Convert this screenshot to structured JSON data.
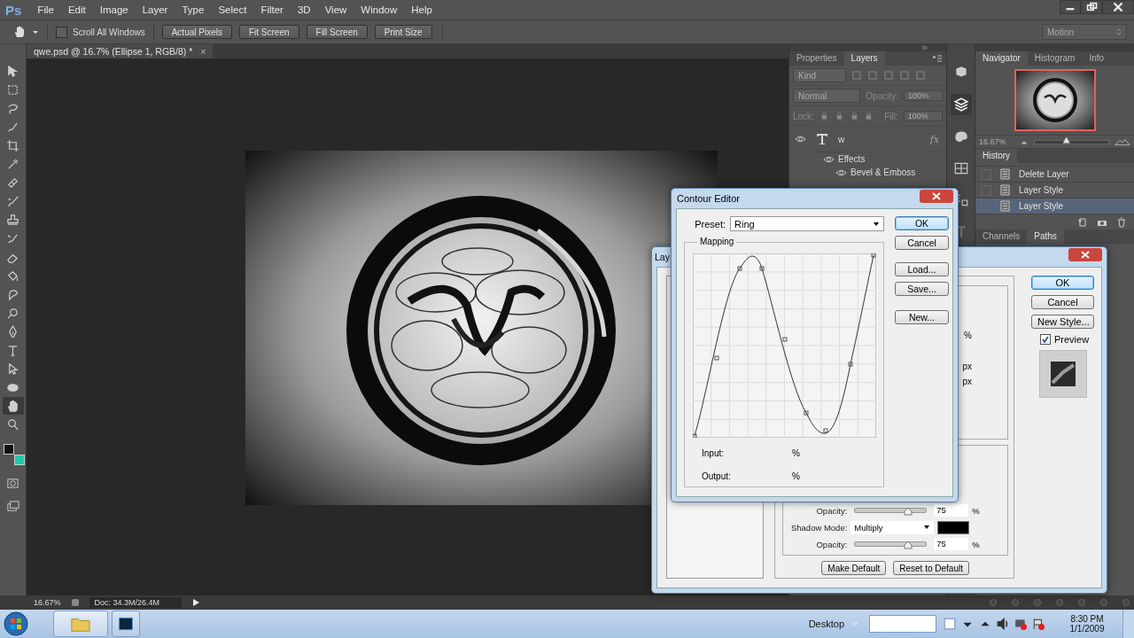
{
  "app_logo": "Ps",
  "menu": [
    "File",
    "Edit",
    "Image",
    "Layer",
    "Type",
    "Select",
    "Filter",
    "3D",
    "View",
    "Window",
    "Help"
  ],
  "options_bar": {
    "scroll_all_windows": {
      "label": "Scroll All Windows",
      "checked": false
    },
    "buttons": [
      "Actual Pixels",
      "Fit Screen",
      "Fill Screen",
      "Print Size"
    ],
    "workspace": "Motion"
  },
  "document_tab": {
    "title": "qwe.psd @ 16.7% (Ellipse 1, RGB/8) *",
    "close": "×"
  },
  "tools": [
    {
      "selected": false
    },
    {
      "selected": false
    },
    {
      "selected": false
    },
    {
      "selected": false
    },
    {
      "selected": false
    },
    {
      "selected": false
    },
    {
      "selected": false
    },
    {
      "selected": false
    },
    {
      "selected": false
    },
    {
      "selected": false
    },
    {
      "selected": false
    },
    {
      "selected": false
    },
    {
      "selected": false
    },
    {
      "selected": false
    },
    {
      "selected": false
    },
    {
      "selected": false
    },
    {
      "selected": false
    },
    {
      "selected": false
    },
    {
      "selected": true
    },
    {
      "selected": false
    }
  ],
  "swatches": [
    {
      "color": "#111111"
    },
    {
      "color": "#1fc9ae"
    }
  ],
  "layers_panel": {
    "tabs": [
      {
        "label": "Properties",
        "selected": false
      },
      {
        "label": "Layers",
        "selected": true
      }
    ],
    "filter": "Kind",
    "blend_mode": "Normal",
    "opacity_label": "Opacity:",
    "opacity": "100%",
    "lock_label": "Lock:",
    "fill_label": "Fill:",
    "fill": "100%",
    "layers": [
      {
        "name": "w",
        "visible": true,
        "fx": "fx",
        "children": [
          {
            "name": "Effects",
            "visible": true,
            "children": [
              {
                "name": "Bevel & Emboss",
                "visible": true
              }
            ]
          }
        ]
      }
    ]
  },
  "navigator": {
    "tabs": [
      {
        "label": "Navigator",
        "selected": true
      },
      {
        "label": "Histogram",
        "selected": false
      },
      {
        "label": "Info",
        "selected": false
      }
    ],
    "zoom": "16.67%",
    "level": 0.43
  },
  "history": {
    "tab": "History",
    "items": [
      {
        "label": "Delete Layer",
        "selected": false
      },
      {
        "label": "Layer Style",
        "selected": false
      },
      {
        "label": "Layer Style",
        "selected": true
      }
    ]
  },
  "lower_tabs": [
    {
      "label": "Channels",
      "selected": false
    },
    {
      "label": "Paths",
      "selected": true
    }
  ],
  "status_bar": {
    "zoom": "16.67%",
    "doc_size": "Doc: 34.3M/26.4M"
  },
  "contour_editor": {
    "title": "Contour Editor",
    "preset_label": "Preset:",
    "preset": "Ring",
    "mapping": "Mapping",
    "input_label": "Input:",
    "input_unit": "%",
    "output_label": "Output:",
    "output_unit": "%",
    "buttons": [
      {
        "label": "OK",
        "default": true
      },
      {
        "label": "Cancel",
        "default": false
      },
      {
        "label": "Load...",
        "default": false
      },
      {
        "label": "Save...",
        "default": false
      },
      {
        "label": "New...",
        "default": false
      }
    ]
  },
  "layer_style": {
    "title": "Lay",
    "units": [
      "%",
      "px",
      "px"
    ],
    "rows": [
      {
        "kind": "slider",
        "label": "Opacity:",
        "level": 0.75,
        "value": "75",
        "unit": "%"
      },
      {
        "kind": "select",
        "label": "Shadow Mode:",
        "value": "Multiply"
      },
      {
        "kind": "slider",
        "label": "Opacity:",
        "level": 0.75,
        "value": "75",
        "unit": "%"
      }
    ],
    "default_buttons": [
      "Make Default",
      "Reset to Default"
    ],
    "buttons": [
      {
        "label": "OK",
        "default": true
      },
      {
        "label": "Cancel",
        "default": false
      },
      {
        "label": "New Style...",
        "default": false
      }
    ],
    "preview": {
      "label": "Preview",
      "checked": true
    }
  },
  "taskbar": {
    "toolbar": "Desktop",
    "time": "8:30 PM",
    "date": "1/1/2009"
  }
}
